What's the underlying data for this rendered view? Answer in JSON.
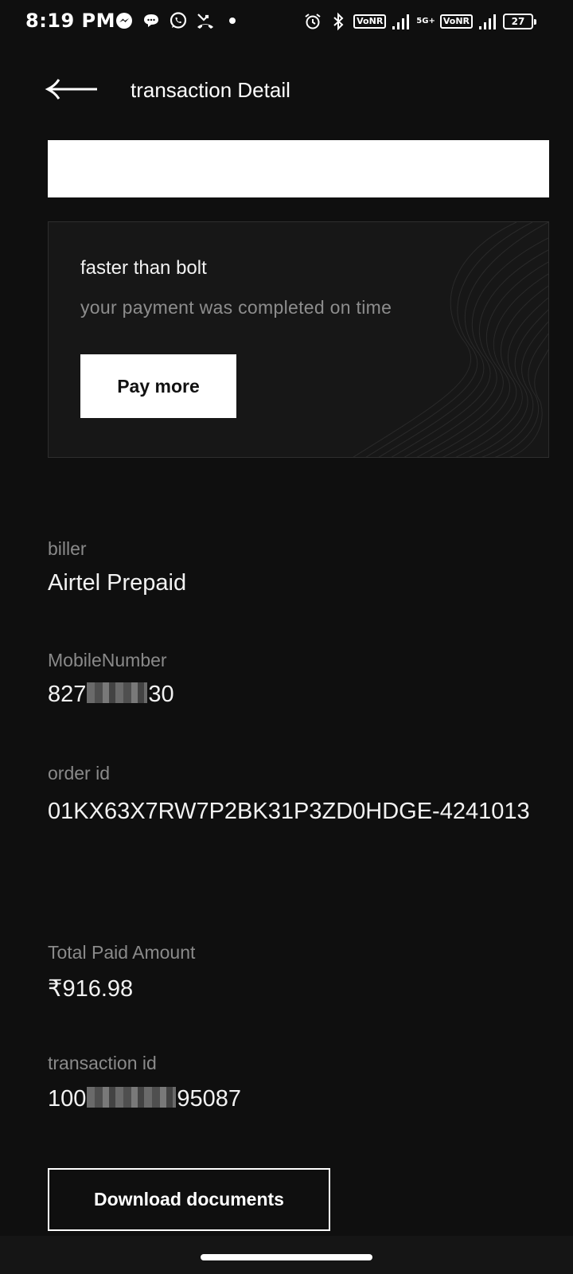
{
  "status_bar": {
    "time": "8:19 PM",
    "left_icons": [
      "messenger-icon",
      "chat-bubble-icon",
      "whatsapp-icon",
      "missed-call-icon",
      "dot-icon"
    ],
    "right_icons": [
      "alarm-icon",
      "bluetooth-icon",
      "signal-icon",
      "signal-icon",
      "battery-icon"
    ],
    "vonr_1": "VoNR",
    "sim2_network": "5G+",
    "vonr_2": "VoNR",
    "battery": "27"
  },
  "header": {
    "title": "transaction Detail"
  },
  "card": {
    "title": "faster than bolt",
    "subtitle": "your payment was completed on time",
    "button_label": "Pay more"
  },
  "details": {
    "biller_label": "biller",
    "biller_value": "Airtel Prepaid",
    "mobile_label": "MobileNumber",
    "mobile_prefix": "827",
    "mobile_suffix": "30",
    "order_label": "order id",
    "order_value": "01KX63X7RW7P2BK31P3ZD0HDGE-4241013",
    "amount_label": "Total Paid Amount",
    "amount_value": "₹916.98",
    "txn_label": "transaction id",
    "txn_prefix": "100",
    "txn_suffix": "95087"
  },
  "actions": {
    "download_label": "Download documents"
  },
  "colors": {
    "background": "#0f0f0f",
    "card": "#171717",
    "label": "#8a8a8a",
    "value": "#f2f2f2",
    "accent": "#ffffff"
  }
}
